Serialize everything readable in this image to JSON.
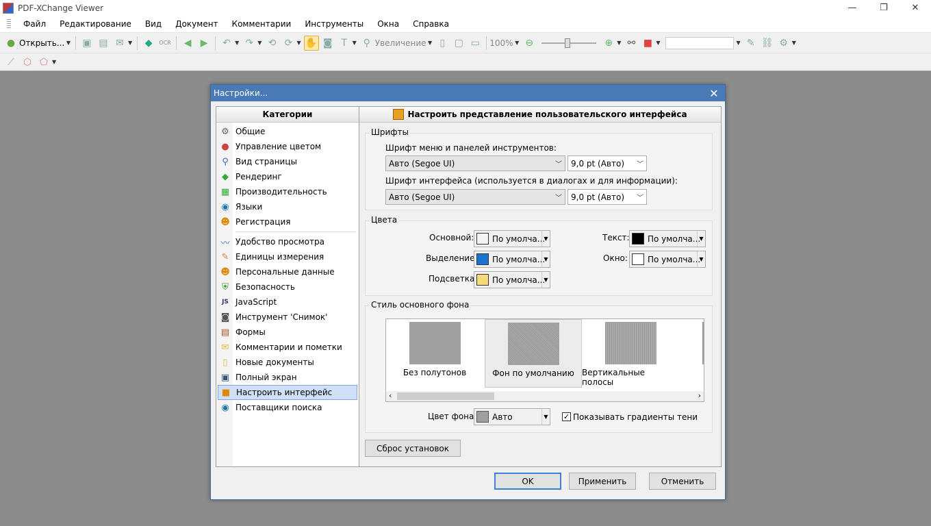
{
  "app": {
    "title": "PDF-XChange Viewer"
  },
  "window_controls": {
    "minimize": "—",
    "restore": "❐",
    "close": "✕"
  },
  "menu": [
    "Файл",
    "Редактирование",
    "Вид",
    "Документ",
    "Комментарии",
    "Инструменты",
    "Окна",
    "Справка"
  ],
  "toolbar": {
    "open_label": "Открыть...",
    "ocr_label": "OCR",
    "zoom_tool_label": "Увеличение",
    "zoom_value": "100%"
  },
  "dialog": {
    "title": "Настройки...",
    "categories_header": "Категории",
    "categories_group1": [
      {
        "label": "Общие",
        "icon": "gears-icon"
      },
      {
        "label": "Управление цветом",
        "icon": "color-icon"
      },
      {
        "label": "Вид страницы",
        "icon": "page-view-icon"
      },
      {
        "label": "Рендеринг",
        "icon": "rendering-icon"
      },
      {
        "label": "Производительность",
        "icon": "performance-icon"
      },
      {
        "label": "Языки",
        "icon": "globe-icon"
      },
      {
        "label": "Регистрация",
        "icon": "registration-icon"
      }
    ],
    "categories_group2": [
      {
        "label": "Удобство просмотра",
        "icon": "accessibility-icon"
      },
      {
        "label": "Единицы измерения",
        "icon": "ruler-icon"
      },
      {
        "label": "Персональные данные",
        "icon": "person-icon"
      },
      {
        "label": "Безопасность",
        "icon": "shield-icon"
      },
      {
        "label": "JavaScript",
        "icon": "javascript-icon"
      },
      {
        "label": "Инструмент 'Снимок'",
        "icon": "camera-icon"
      },
      {
        "label": "Формы",
        "icon": "forms-icon"
      },
      {
        "label": "Комментарии и пометки",
        "icon": "comments-icon"
      },
      {
        "label": "Новые документы",
        "icon": "new-document-icon"
      },
      {
        "label": "Полный экран",
        "icon": "fullscreen-icon"
      },
      {
        "label": "Настроить интерфейс",
        "icon": "customize-ui-icon",
        "selected": true
      },
      {
        "label": "Поставщики поиска",
        "icon": "search-providers-icon"
      }
    ],
    "panel_header": "Настроить представление пользовательского интерфейса",
    "fonts": {
      "group_title": "Шрифты",
      "menu_font_label": "Шрифт меню и панелей инструментов:",
      "menu_font_value": "Авто (Segoe UI)",
      "menu_size_value": "9,0 pt (Авто)",
      "ui_font_label": "Шрифт интерфейса (используется в диалогах и для информации):",
      "ui_font_value": "Авто (Segoe UI)",
      "ui_size_value": "9,0 pt (Авто)"
    },
    "colors": {
      "group_title": "Цвета",
      "main_label": "Основной:",
      "main_value": "По умолча...",
      "main_color": "#f4f4f4",
      "selection_label": "Выделение:",
      "selection_value": "По умолча...",
      "selection_color": "#1874d0",
      "highlight_label": "Подсветка:",
      "highlight_value": "По умолча...",
      "highlight_color": "#f5d97a",
      "text_label": "Текст:",
      "text_value": "По умолча...",
      "text_color": "#000000",
      "window_label": "Окно:",
      "window_value": "По умолча...",
      "window_color": "#ffffff"
    },
    "background": {
      "group_title": "Стиль основного фона",
      "styles": [
        {
          "label": "Без полутонов"
        },
        {
          "label": "Фон по умолчанию",
          "selected": true
        },
        {
          "label": "Вертикальные полосы"
        }
      ],
      "bg_color_label": "Цвет фона:",
      "bg_color_value": "Авто",
      "bg_color": "#a0a0a0",
      "gradient_label": "Показывать градиенты тени",
      "gradient_checked": true
    },
    "reset_button": "Сброс установок",
    "ok_button": "OK",
    "apply_button": "Применить",
    "cancel_button": "Отменить"
  }
}
